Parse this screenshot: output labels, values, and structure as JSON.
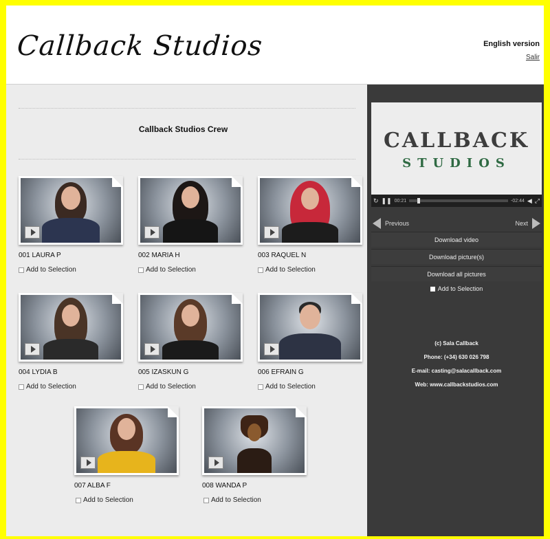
{
  "header": {
    "logo": "Callback Studios",
    "language_link": "English version",
    "exit_link": "Salir"
  },
  "main": {
    "crew_title": "Callback Studios Crew",
    "select_label": "Add to Selection",
    "cards": [
      {
        "name": "001 LAURA P"
      },
      {
        "name": "002 MARIA H"
      },
      {
        "name": "003 RAQUEL N"
      },
      {
        "name": "004 LYDIA B"
      },
      {
        "name": "005 IZASKUN G"
      },
      {
        "name": "006 EFRAIN G"
      },
      {
        "name": "007 ALBA F"
      },
      {
        "name": "008 WANDA P"
      }
    ]
  },
  "sidebar": {
    "video": {
      "title_line1": "CALLBACK",
      "title_line2": "STUDIOS",
      "time_elapsed": "00:21",
      "time_remaining": "-02:44"
    },
    "previous_label": "Previous",
    "next_label": "Next",
    "actions": [
      "Download video",
      "Download picture(s)",
      "Download all pictures"
    ],
    "select_label": "Add to Selection",
    "contact": {
      "copyright": "(c) Sala Callback",
      "phone": "Phone: (+34) 630 026 798",
      "email": "E-mail: casting@salacallback.com",
      "web": "Web: www.callbackstudios.com"
    }
  },
  "colors": {
    "frame_border": "#ffff00",
    "sidebar_bg": "#3a3a3a",
    "main_bg": "#ececec"
  }
}
